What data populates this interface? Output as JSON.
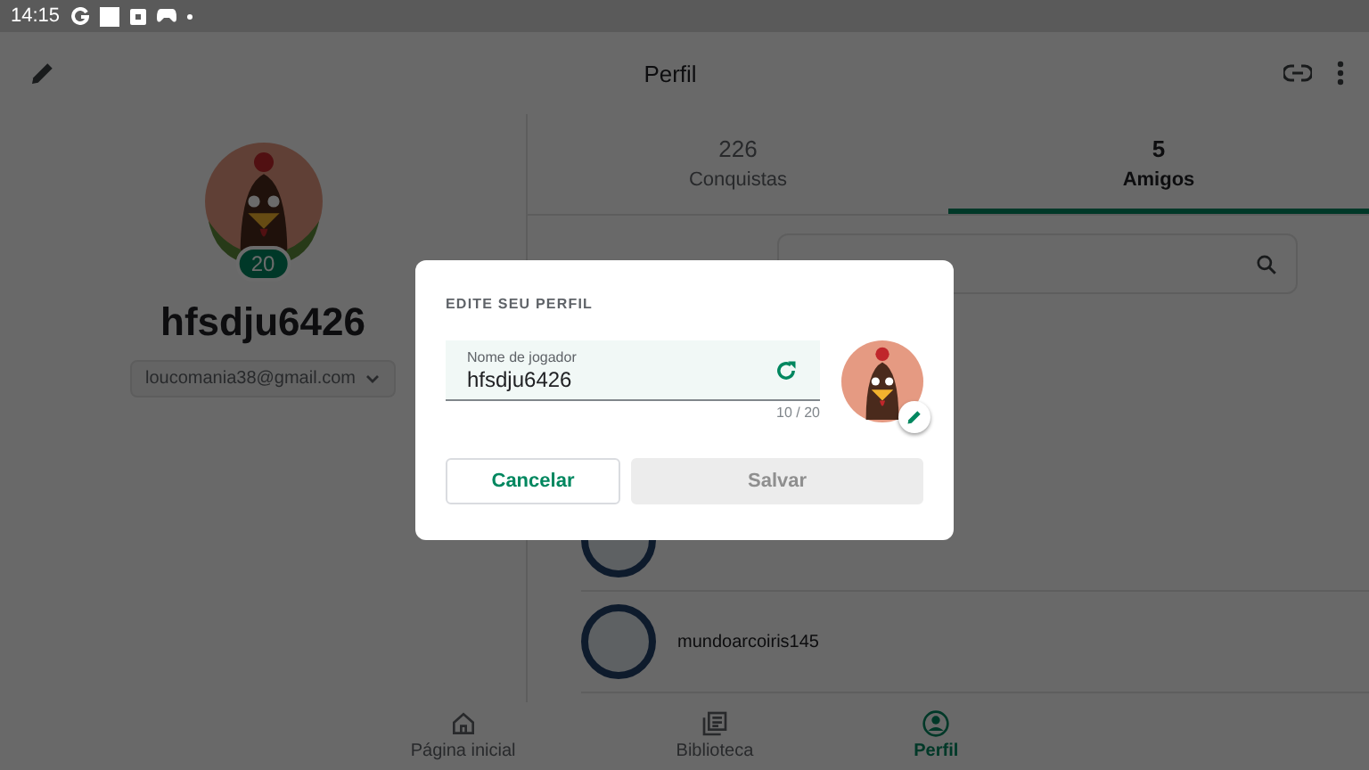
{
  "status_bar": {
    "time": "14:15"
  },
  "app_bar": {
    "title": "Perfil"
  },
  "profile": {
    "level": "20",
    "name": "hfsdju6426",
    "email": "loucomania38@gmail.com"
  },
  "tabs": [
    {
      "count": "226",
      "label": "Conquistas",
      "selected": false
    },
    {
      "count": "5",
      "label": "Amigos",
      "selected": true
    }
  ],
  "friends": [
    {
      "kind": "covered"
    },
    {
      "kind": "named",
      "name": "mundoarcoiris145"
    }
  ],
  "bottom_nav": [
    {
      "label": "Página inicial",
      "kind": "home",
      "selected": false
    },
    {
      "label": "Biblioteca",
      "kind": "library",
      "selected": false
    },
    {
      "label": "Perfil",
      "kind": "person",
      "selected": true
    }
  ],
  "dialog": {
    "title": "EDITE SEU PERFIL",
    "field": {
      "label": "Nome de jogador",
      "value": "hfsdju6426",
      "counter": "10 / 20"
    },
    "buttons": [
      {
        "label": "Cancelar",
        "disabled": false
      },
      {
        "label": "Salvar",
        "disabled": true
      }
    ]
  }
}
